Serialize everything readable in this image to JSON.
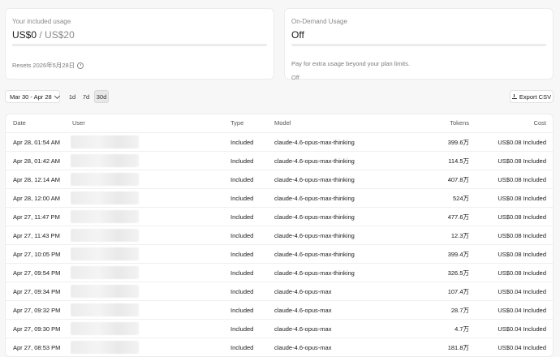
{
  "included": {
    "label": "Your included usage",
    "used": "US$0",
    "separator": " / ",
    "limit": "US$20",
    "progress_fraction": 0,
    "resets": "Resets 2026年5月28日"
  },
  "on_demand": {
    "label": "On-Demand Usage",
    "value": "Off",
    "description": "Pay for extra usage beyond your plan limits.",
    "status": "Off"
  },
  "toolbar": {
    "date_range": "Mar 30 - Apr 28",
    "periods": [
      "1d",
      "7d",
      "30d"
    ],
    "active_period": "30d",
    "export_label": "Export CSV"
  },
  "table": {
    "headers": {
      "date": "Date",
      "user": "User",
      "type": "Type",
      "model": "Model",
      "tokens": "Tokens",
      "cost": "Cost"
    },
    "rows": [
      {
        "date": "Apr 28, 01:54 AM",
        "type": "Included",
        "model": "claude-4.6-opus-max-thinking",
        "tokens": "399.6万",
        "cost": "US$0.08 Included"
      },
      {
        "date": "Apr 28, 01:42 AM",
        "type": "Included",
        "model": "claude-4.6-opus-max-thinking",
        "tokens": "114.5万",
        "cost": "US$0.08 Included"
      },
      {
        "date": "Apr 28, 12:14 AM",
        "type": "Included",
        "model": "claude-4.6-opus-max-thinking",
        "tokens": "407.8万",
        "cost": "US$0.08 Included"
      },
      {
        "date": "Apr 28, 12:00 AM",
        "type": "Included",
        "model": "claude-4.6-opus-max-thinking",
        "tokens": "524万",
        "cost": "US$0.08 Included"
      },
      {
        "date": "Apr 27, 11:47 PM",
        "type": "Included",
        "model": "claude-4.6-opus-max-thinking",
        "tokens": "477.6万",
        "cost": "US$0.08 Included"
      },
      {
        "date": "Apr 27, 11:43 PM",
        "type": "Included",
        "model": "claude-4.6-opus-max-thinking",
        "tokens": "12.3万",
        "cost": "US$0.08 Included"
      },
      {
        "date": "Apr 27, 10:05 PM",
        "type": "Included",
        "model": "claude-4.6-opus-max-thinking",
        "tokens": "399.4万",
        "cost": "US$0.08 Included"
      },
      {
        "date": "Apr 27, 09:54 PM",
        "type": "Included",
        "model": "claude-4.6-opus-max-thinking",
        "tokens": "326.5万",
        "cost": "US$0.08 Included"
      },
      {
        "date": "Apr 27, 09:34 PM",
        "type": "Included",
        "model": "claude-4.6-opus-max",
        "tokens": "107.4万",
        "cost": "US$0.04 Included"
      },
      {
        "date": "Apr 27, 09:32 PM",
        "type": "Included",
        "model": "claude-4.6-opus-max",
        "tokens": "28.7万",
        "cost": "US$0.04 Included"
      },
      {
        "date": "Apr 27, 09:30 PM",
        "type": "Included",
        "model": "claude-4.6-opus-max",
        "tokens": "4.7万",
        "cost": "US$0.04 Included"
      },
      {
        "date": "Apr 27, 08:53 PM",
        "type": "Included",
        "model": "claude-4.6-opus-max",
        "tokens": "181.8万",
        "cost": "US$0.04 Included"
      }
    ]
  },
  "colors": {
    "accent": "#4c8bf5",
    "background": "#f7f7f7",
    "muted_text": "#8a8a8a"
  }
}
